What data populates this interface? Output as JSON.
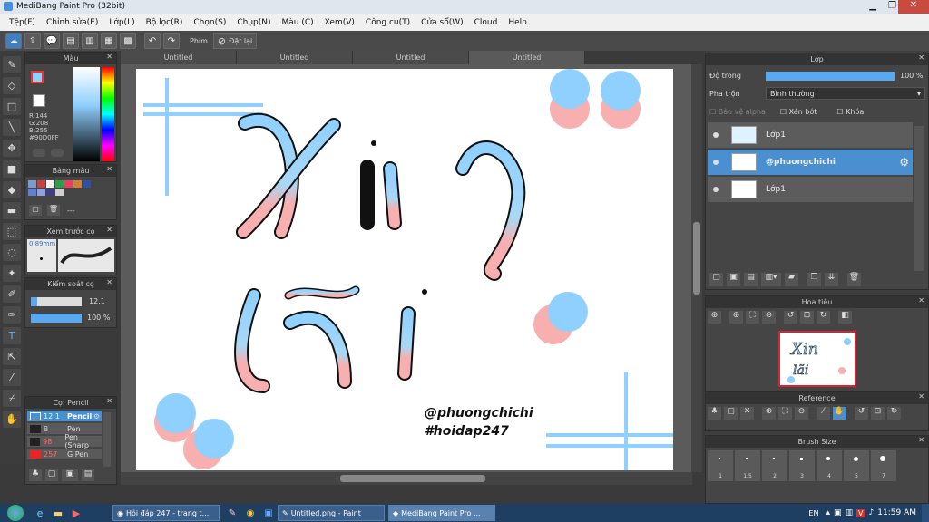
{
  "window": {
    "title": "MediBang Paint Pro (32bit)"
  },
  "menu": [
    "Tệp(F)",
    "Chỉnh sửa(E)",
    "Lớp(L)",
    "Bộ lọc(R)",
    "Chọn(S)",
    "Chụp(N)",
    "Màu (C)",
    "Xem(V)",
    "Công cụ(T)",
    "Cửa sổ(W)",
    "Cloud",
    "Help"
  ],
  "toolbar": {
    "phim_label": "Phím",
    "reset_label": "Đặt lại"
  },
  "tabs": [
    "Untitled",
    "Untitled",
    "Untitled",
    "Untitled"
  ],
  "color_panel": {
    "title": "Màu",
    "r": "R:144",
    "g": "G:208",
    "b": "B:255",
    "hex": "#90D0FF"
  },
  "palette_panel": {
    "title": "Bảng màu",
    "more": "---"
  },
  "brush_preview": {
    "title": "Xem trước cọ",
    "size": "0.89mm"
  },
  "brush_control": {
    "title": "Kiểm soát cọ",
    "size_value": "12.1",
    "opacity_value": "100 %"
  },
  "brush_list": {
    "title": "Cọ: Pencil",
    "items": [
      {
        "size": "12.1",
        "name": "Pencil"
      },
      {
        "size": "8",
        "name": "Pen"
      },
      {
        "size": "98",
        "name": "Pen (Sharp"
      },
      {
        "size": "257",
        "name": "G Pen"
      }
    ]
  },
  "layer_panel": {
    "title": "Lớp",
    "opacity_label": "Độ trong",
    "opacity_value": "100 %",
    "blend_label": "Pha trộn",
    "blend_value": "Bình thường",
    "protect_alpha": "Bảo vệ alpha",
    "clip": "Xén bớt",
    "lock": "Khóa",
    "layers": [
      "Lớp1",
      "@phuongchichi",
      "Lớp1"
    ]
  },
  "navigator": {
    "title": "Hoa tiêu"
  },
  "reference": {
    "title": "Reference"
  },
  "brush_size": {
    "title": "Brush Size",
    "sizes": [
      "1",
      "1.5",
      "2",
      "3",
      "4",
      "5",
      "7"
    ]
  },
  "canvas_text": {
    "line1": "@phuongchichi",
    "line2": "#hoidap247"
  },
  "taskbar": {
    "tasks": [
      "Hỏi đáp 247 - trang t...",
      "Untitled.png - Paint",
      "MediBang Paint Pro ..."
    ],
    "lang": "EN",
    "time": "11:59 AM"
  },
  "colors": {
    "blue": "#90D0FF",
    "pink": "#F7AFB0",
    "accent": "#4a8fd0"
  }
}
